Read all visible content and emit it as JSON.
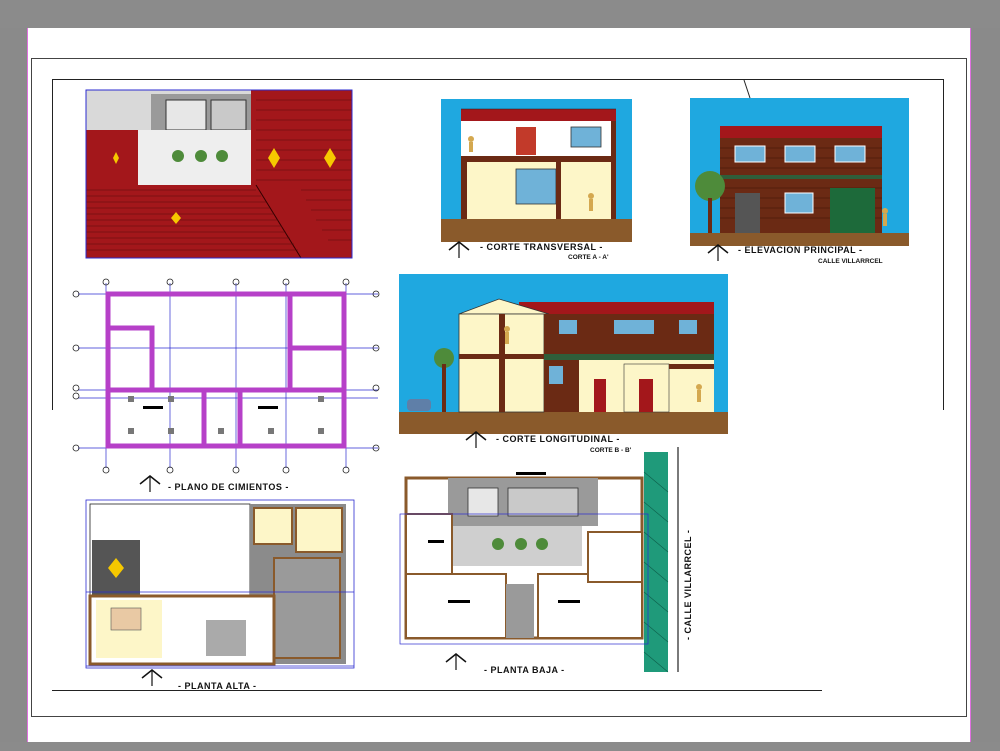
{
  "drawing": {
    "labels": {
      "corte_transversal": "- CORTE TRANSVERSAL -",
      "corte_a": "CORTE A - A'",
      "elevacion": "- ELEVACION PRINCIPAL -",
      "calle_elev": "CALLE VILLARRCEL",
      "corte_longitudinal": "- CORTE LONGITUDINAL -",
      "corte_b": "CORTE B - B'",
      "plano_cimientos": "- PLANO DE CIMIENTOS -",
      "planta_alta": "- PLANTA ALTA -",
      "planta_baja": "- PLANTA BAJA -",
      "calle_vertical": "- CALLE VILLARRCEL -"
    },
    "colors": {
      "roof_red": "#a3171b",
      "wall_cream": "#fdf6c8",
      "sky_blue": "#1fa8e0",
      "ground_brown": "#8a5a2b",
      "foundation_purple": "#b640c8",
      "dim_blue": "#2b2bd0",
      "wood_brown": "#6b2a14",
      "street_green": "#1f9a7a"
    }
  }
}
